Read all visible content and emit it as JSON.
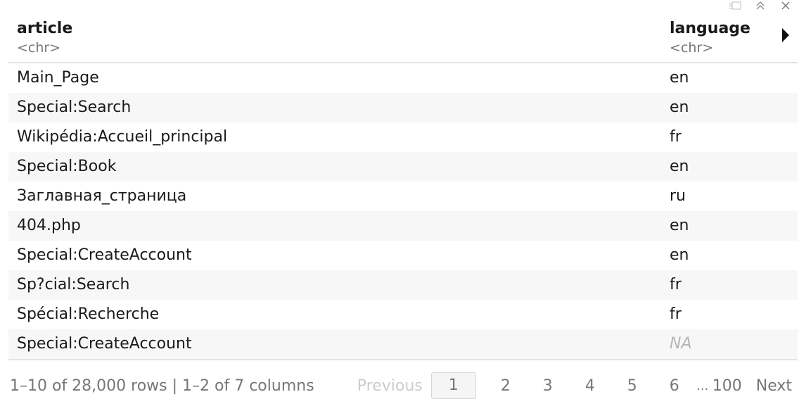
{
  "toolbar": {
    "icons": [
      "popout-icon",
      "collapse-icon",
      "close-icon"
    ]
  },
  "table": {
    "columns": [
      {
        "name": "article",
        "type": "<chr>"
      },
      {
        "name": "language",
        "type": "<chr>"
      }
    ],
    "rows": [
      {
        "article": "Main_Page",
        "language": "en"
      },
      {
        "article": "Special:Search",
        "language": "en"
      },
      {
        "article": "Wikipédia:Accueil_principal",
        "language": "fr"
      },
      {
        "article": "Special:Book",
        "language": "en"
      },
      {
        "article": "Заглавная_страница",
        "language": "ru"
      },
      {
        "article": "404.php",
        "language": "en"
      },
      {
        "article": "Special:CreateAccount",
        "language": "en"
      },
      {
        "article": "Sp?cial:Search",
        "language": "fr"
      },
      {
        "article": "Spécial:Recherche",
        "language": "fr"
      },
      {
        "article": "Special:CreateAccount",
        "language": "NA"
      }
    ]
  },
  "footer": {
    "info": "1–10 of 28,000 rows | 1–2 of 7 columns",
    "previous_label": "Previous",
    "pages": [
      "1",
      "2",
      "3",
      "4",
      "5",
      "6"
    ],
    "ellipsis": "...",
    "last_page": "100",
    "next_label": "Next"
  },
  "colors": {
    "header_border": "#e3e3e3",
    "alt_row_bg": "#f7f7f7",
    "muted_text": "#777777",
    "na_text": "#b5b5b5"
  }
}
